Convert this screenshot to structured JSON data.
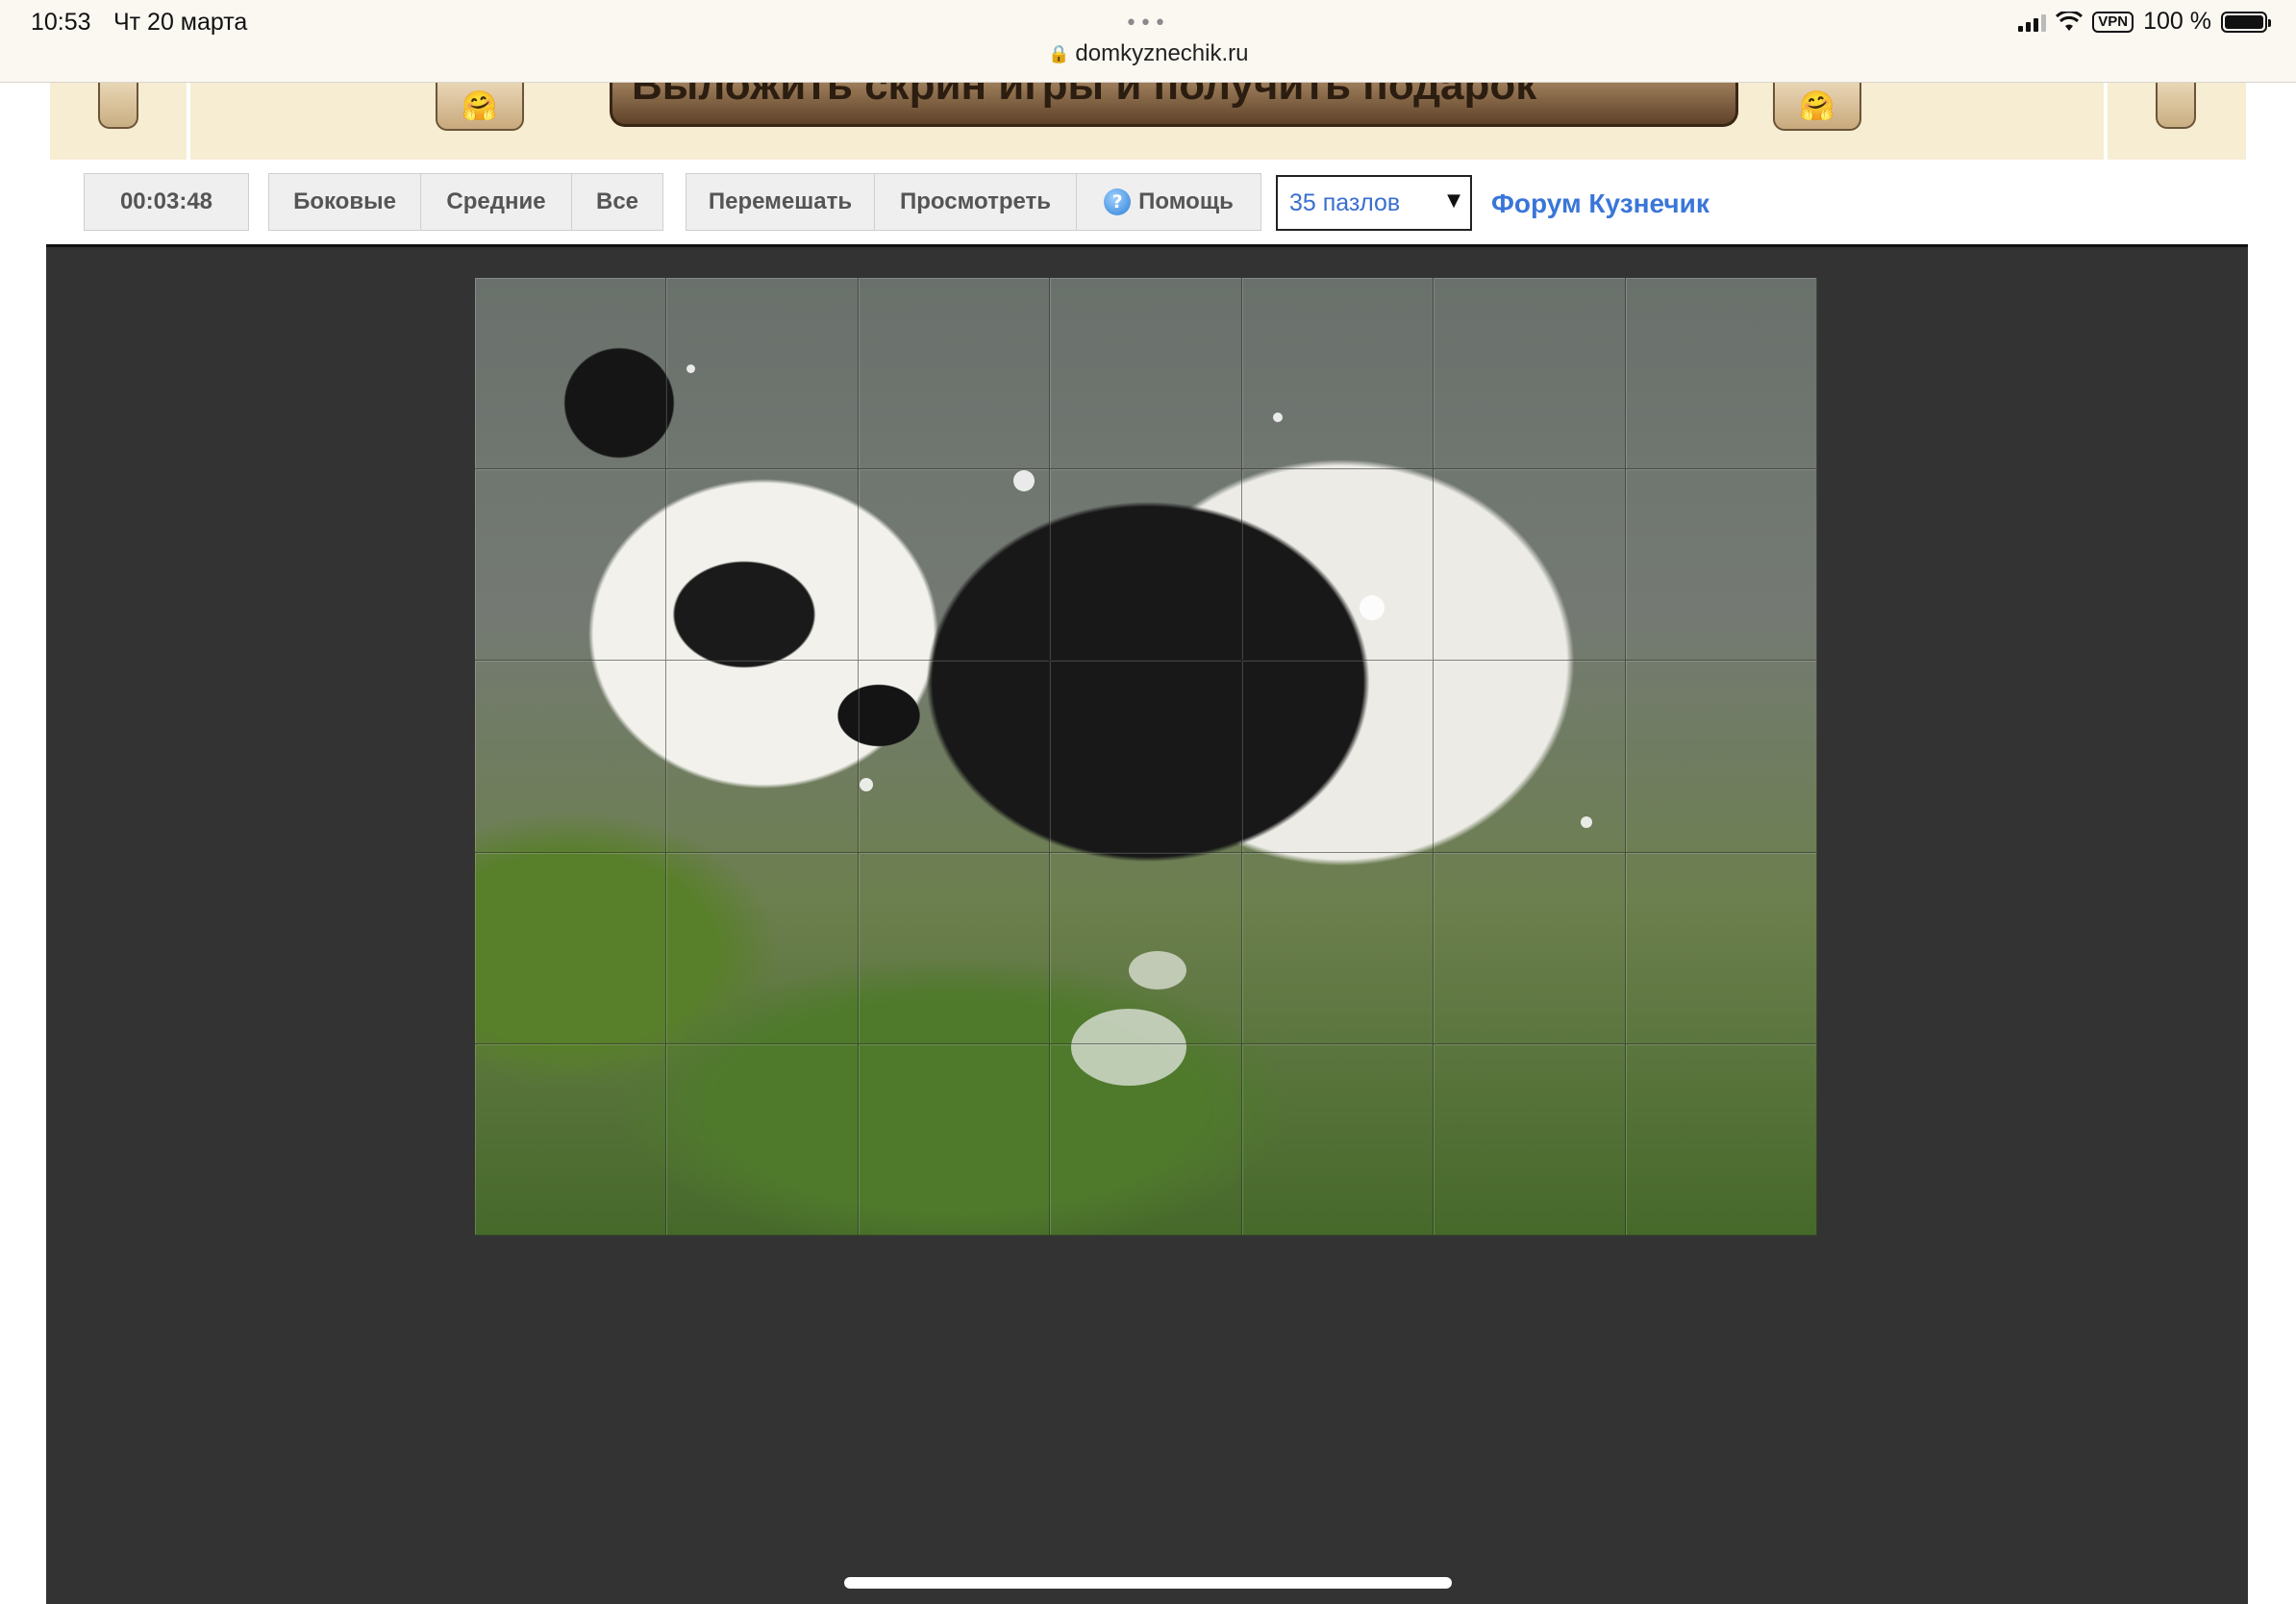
{
  "status_bar": {
    "time": "10:53",
    "date": "Чт 20 марта",
    "dots": "•••",
    "url": "domkyznechik.ru",
    "vpn": "VPN",
    "battery": "100 %"
  },
  "banner": {
    "headline": "Выложить скрин игры и получить подарок",
    "emoji": "🤗"
  },
  "toolbar": {
    "timer": "00:03:48",
    "filter_buttons": [
      "Боковые",
      "Средние",
      "Все"
    ],
    "action_buttons": {
      "shuffle": "Перемешать",
      "preview": "Просмотреть",
      "help": "Помощь",
      "help_icon": "?"
    },
    "pieces_select": "35 пазлов",
    "forum_link": "Форум Кузнечик"
  },
  "puzzle": {
    "columns": 7,
    "rows": 5,
    "pieces_total": 35
  },
  "colors": {
    "board_bg": "#333333",
    "banner_bg": "#f6edd3",
    "link": "#3a76d9",
    "button_bg": "#efefef"
  }
}
